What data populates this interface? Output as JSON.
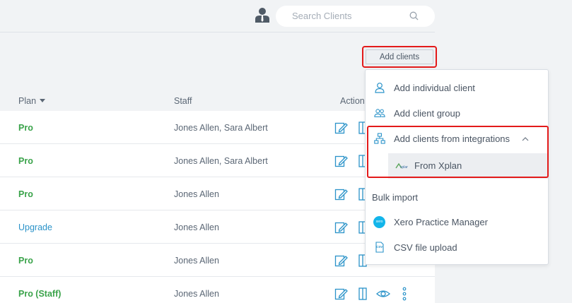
{
  "header": {
    "search_placeholder": "Search Clients"
  },
  "toolbar": {
    "add_clients_label": "Add clients"
  },
  "table": {
    "columns": {
      "plan": "Plan",
      "staff": "Staff",
      "actions": "Actions"
    },
    "rows": [
      {
        "plan": "Pro",
        "staff": "Jones Allen, Sara Albert"
      },
      {
        "plan": "Pro",
        "staff": "Jones Allen, Sara Albert"
      },
      {
        "plan": "Pro",
        "staff": "Jones Allen"
      },
      {
        "plan": "Upgrade",
        "staff": "Jones Allen"
      },
      {
        "plan": "Pro",
        "staff": "Jones Allen"
      },
      {
        "plan": "Pro (Staff)",
        "staff": "Jones Allen"
      }
    ]
  },
  "menu": {
    "add_individual": "Add individual client",
    "add_group": "Add client group",
    "add_integrations": "Add clients from integrations",
    "from_xplan": "From Xplan",
    "bulk_import": "Bulk import",
    "xero": "Xero Practice Manager",
    "xero_badge": "xero",
    "csv": "CSV file upload",
    "csv_badge": "CSV"
  },
  "colors": {
    "accent": "#2b93c9",
    "pro_green": "#3aa34a",
    "highlight_red": "#e31a1a",
    "xero_blue": "#13b5ea"
  }
}
